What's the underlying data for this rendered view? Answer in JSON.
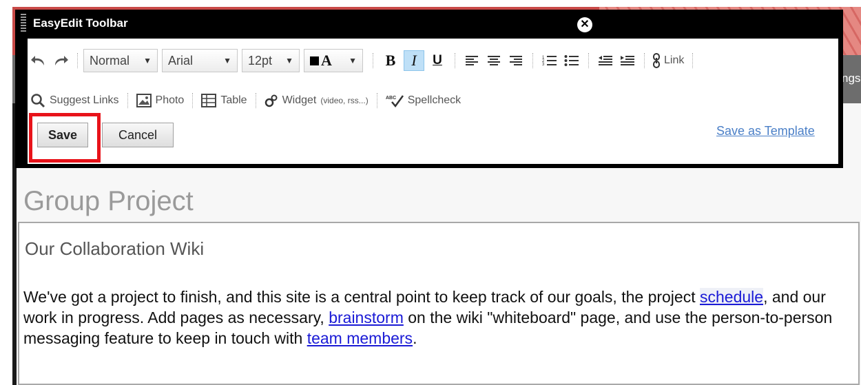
{
  "window": {
    "title": "EasyEdit Toolbar",
    "close_icon": "close-icon",
    "bg_right_label": "ngs"
  },
  "toolbar": {
    "row1": {
      "undo_icon": "undo-icon",
      "redo_icon": "redo-icon",
      "style_select": "Normal",
      "font_select": "Arial",
      "size_select": "12pt",
      "color_select": "A",
      "bold": "B",
      "italic": "I",
      "underline": "U",
      "align_left_icon": "align-left-icon",
      "align_center_icon": "align-center-icon",
      "align_right_icon": "align-right-icon",
      "ordered_list_icon": "ordered-list-icon",
      "bullet_list_icon": "bullet-list-icon",
      "outdent_icon": "outdent-icon",
      "indent_icon": "indent-icon",
      "link_label": "Link"
    },
    "row2": {
      "suggest_links": "Suggest Links",
      "photo": "Photo",
      "table": "Table",
      "widget": "Widget",
      "widget_hint": "(video, rss...)",
      "spellcheck": "Spellcheck"
    },
    "save_label": "Save",
    "cancel_label": "Cancel",
    "save_as_template": "Save as Template"
  },
  "page": {
    "title": "Group Project",
    "wiki_heading": "Our Collaboration Wiki",
    "paragraph": {
      "part1": "We've got a project to finish, and this site is a central point to keep track of our goals, the project ",
      "link1": "schedule",
      "part2": ", and our work in progress. Add pages as necessary, ",
      "link2": "brainstorm",
      "part3": " on the wiki \"whiteboard\" page, and use the person-to-person messaging feature to keep in touch with ",
      "link3": "team members",
      "part4": "."
    }
  },
  "colors": {
    "highlight": "#e8131a",
    "link": "#1a1ad6",
    "active_button": "#bfe0f7"
  }
}
